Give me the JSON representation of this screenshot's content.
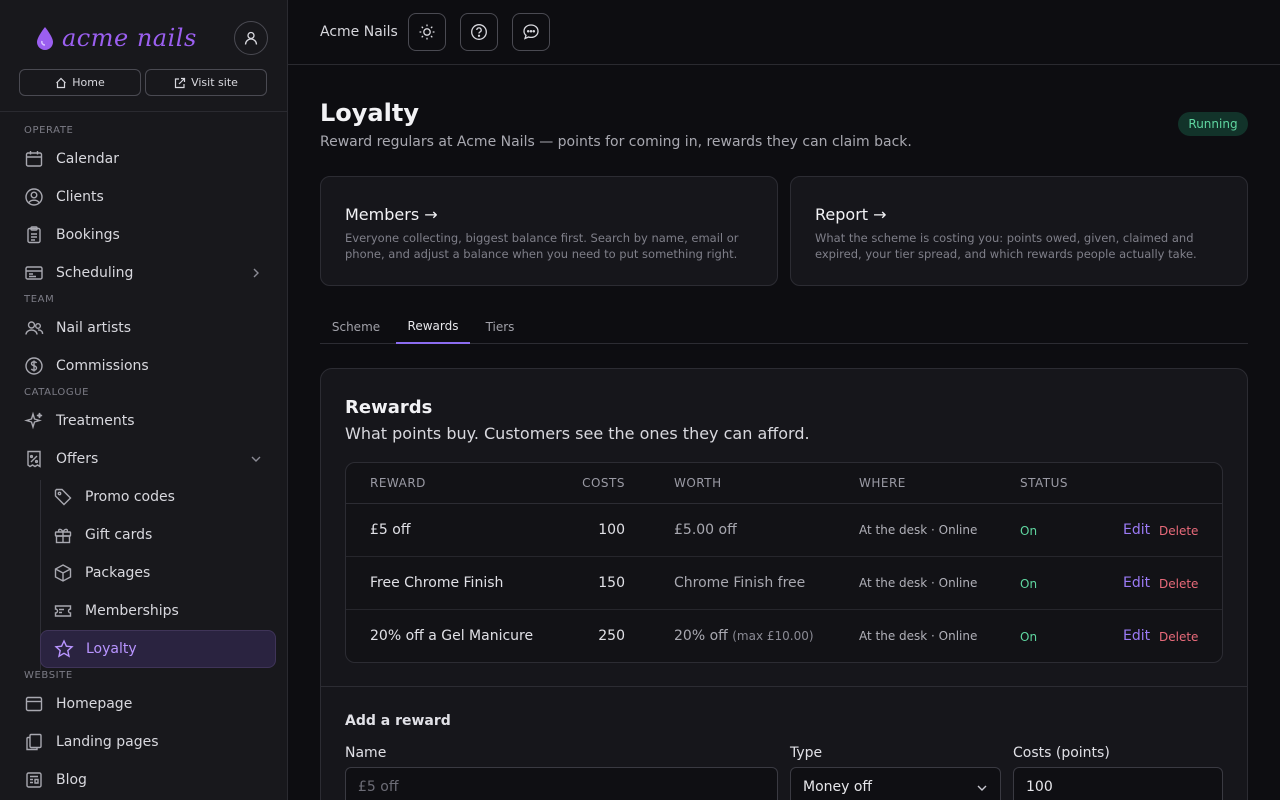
{
  "brand": {
    "name": "acme nails",
    "accent": "#9b5ff0"
  },
  "sidebar": {
    "home_label": "Home",
    "visit_label": "Visit site",
    "sections": {
      "operate": "OPERATE",
      "team": "TEAM",
      "catalogue": "CATALOGUE",
      "website": "WEBSITE"
    },
    "items": {
      "calendar": "Calendar",
      "clients": "Clients",
      "bookings": "Bookings",
      "scheduling": "Scheduling",
      "nail_artists": "Nail artists",
      "commissions": "Commissions",
      "treatments": "Treatments",
      "offers": "Offers",
      "promo_codes": "Promo codes",
      "gift_cards": "Gift cards",
      "packages": "Packages",
      "memberships": "Memberships",
      "loyalty": "Loyalty",
      "homepage": "Homepage",
      "landing_pages": "Landing pages",
      "blog": "Blog"
    }
  },
  "topbar": {
    "title": "Acme Nails"
  },
  "page": {
    "title": "Loyalty",
    "subtitle": "Reward regulars at Acme Nails — points for coming in, rewards they can claim back.",
    "status": "Running"
  },
  "cards": {
    "members": {
      "title": "Members →",
      "desc": "Everyone collecting, biggest balance first. Search by name, email or phone, and adjust a balance when you need to put something right."
    },
    "report": {
      "title": "Report →",
      "desc": "What the scheme is costing you: points owed, given, claimed and expired, your tier spread, and which rewards people actually take."
    }
  },
  "tabs": {
    "scheme": "Scheme",
    "rewards": "Rewards",
    "tiers": "Tiers"
  },
  "rewards": {
    "title": "Rewards",
    "subtitle": "What points buy. Customers see the ones they can afford.",
    "headers": {
      "reward": "REWARD",
      "costs": "COSTS",
      "worth": "WORTH",
      "where": "WHERE",
      "status": "STATUS"
    },
    "edit_label": "Edit",
    "delete_label": "Delete",
    "rows": [
      {
        "reward": "£5 off",
        "costs": "100",
        "worth": "£5.00 off",
        "worth_note": "",
        "where": "At the desk · Online",
        "status": "On"
      },
      {
        "reward": "Free Chrome Finish",
        "costs": "150",
        "worth": "Chrome Finish free",
        "worth_note": "",
        "where": "At the desk · Online",
        "status": "On"
      },
      {
        "reward": "20% off a Gel Manicure",
        "costs": "250",
        "worth": "20% off",
        "worth_note": "(max £10.00)",
        "where": "At the desk · Online",
        "status": "On"
      }
    ]
  },
  "add_reward": {
    "title": "Add a reward",
    "name_label": "Name",
    "name_placeholder": "£5 off",
    "type_label": "Type",
    "type_value": "Money off",
    "costs_label": "Costs (points)",
    "costs_value": "100"
  }
}
